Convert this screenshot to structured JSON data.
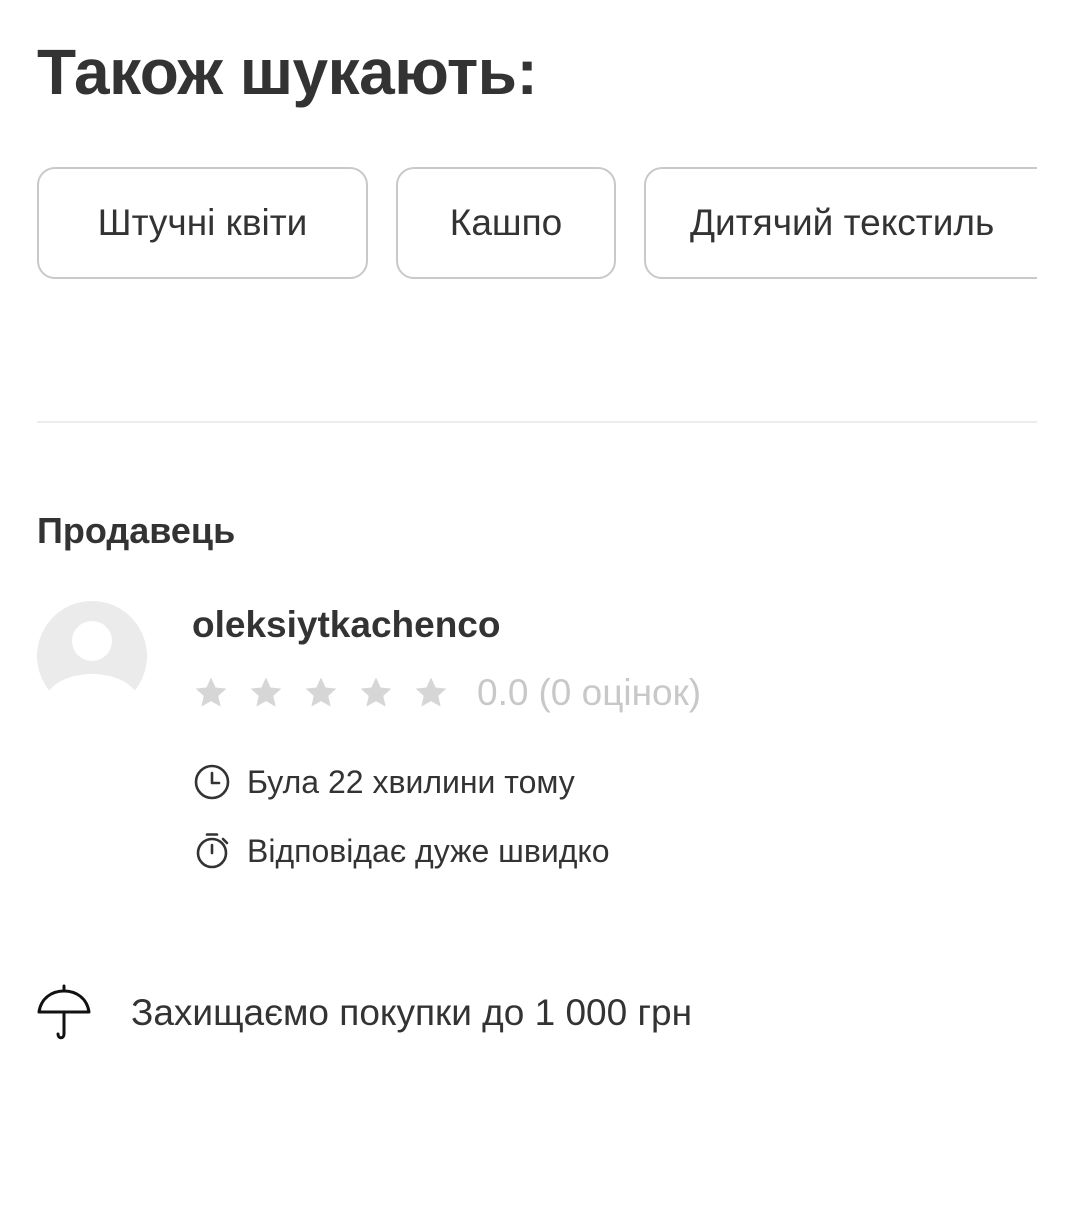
{
  "also_searched": {
    "title": "Також шукають:",
    "chips": [
      {
        "label": "Штучні квіти"
      },
      {
        "label": "Кашпо"
      },
      {
        "label": "Дитячий текстиль"
      }
    ]
  },
  "seller": {
    "heading": "Продавець",
    "avatar_icon": "user-avatar-placeholder-icon",
    "name": "oleksiytkachenco",
    "rating": {
      "stars_total": 5,
      "stars_filled": 0,
      "value": "0.0",
      "count_text": "(0 оцінок)",
      "star_color": "#d6d6d6"
    },
    "last_seen": {
      "icon": "clock-icon",
      "text": "Була 22 хвилини тому"
    },
    "response": {
      "icon": "stopwatch-icon",
      "text": "Відповідає дуже швидко"
    }
  },
  "protection": {
    "icon": "umbrella-icon",
    "text": "Захищаємо покупки до 1 000 грн"
  },
  "colors": {
    "text": "#333333",
    "muted": "#c8c8c8",
    "border": "#c9c9c9",
    "divider": "#ececec",
    "avatar_bg": "#ebebeb"
  }
}
